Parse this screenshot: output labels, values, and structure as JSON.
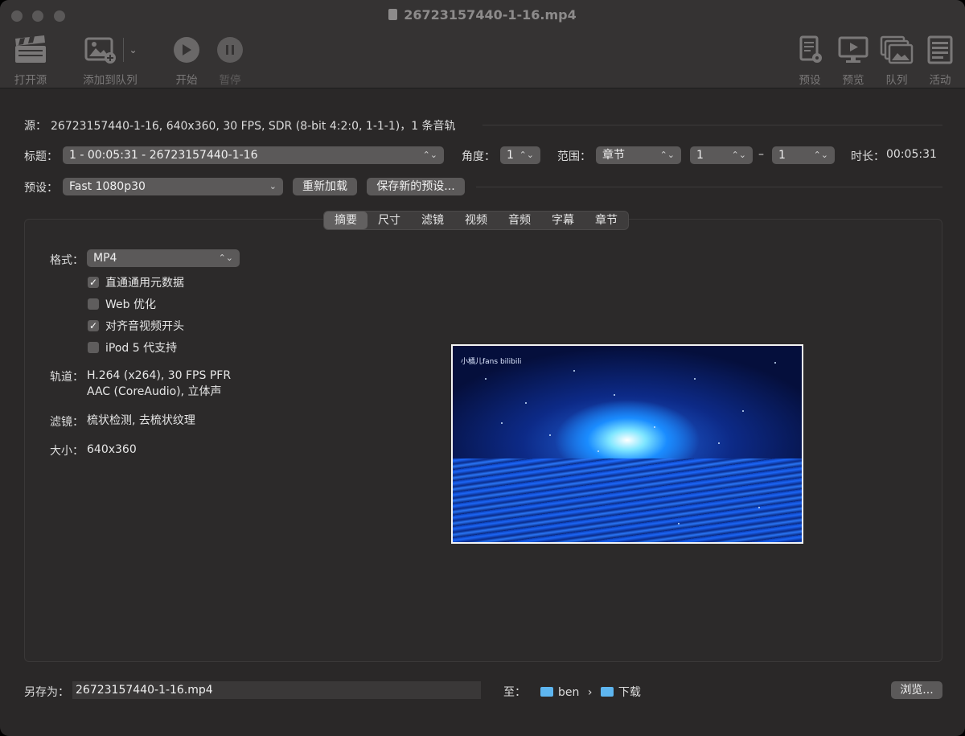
{
  "window": {
    "title": "26723157440-1-16.mp4"
  },
  "toolbar": {
    "open_source": "打开源",
    "add_to_queue": "添加到队列",
    "start": "开始",
    "pause": "暂停",
    "presets": "预设",
    "preview": "预览",
    "queue": "队列",
    "activity": "活动"
  },
  "source": {
    "label": "源：",
    "value": "26723157440-1-16, 640x360, 30 FPS, SDR (8-bit 4:2:0, 1-1-1)，1 条音轨"
  },
  "title_row": {
    "label": "标题：",
    "title_value": "1 - 00:05:31 - 26723157440-1-16",
    "angle_label": "角度：",
    "angle_value": "1",
    "range_label": "范围：",
    "range_type": "章节",
    "range_start": "1",
    "range_dash": "–",
    "range_end": "1",
    "duration_label": "时长：",
    "duration_value": "00:05:31"
  },
  "preset_row": {
    "label": "预设：",
    "value": "Fast 1080p30",
    "reload_button": "重新加载",
    "save_preset_button": "保存新的预设..."
  },
  "tabs": [
    "摘要",
    "尺寸",
    "滤镜",
    "视频",
    "音频",
    "字幕",
    "章节"
  ],
  "summary": {
    "format_label": "格式：",
    "format_value": "MP4",
    "options": [
      {
        "label": "直通通用元数据",
        "checked": true
      },
      {
        "label": "Web 优化",
        "checked": false
      },
      {
        "label": "对齐音视频开头",
        "checked": true
      },
      {
        "label": "iPod 5 代支持",
        "checked": false
      }
    ],
    "tracks_label": "轨道：",
    "tracks_line1": "H.264 (x264), 30 FPS PFR",
    "tracks_line2": "AAC (CoreAudio), 立体声",
    "filters_label": "滤镜：",
    "filters_value": "梳状检测, 去梳状纹理",
    "size_label": "大小：",
    "size_value": "640x360",
    "preview_watermark": "小橘儿fans bilibili"
  },
  "footer": {
    "save_as_label": "另存为：",
    "save_as_value": "26723157440-1-16.mp4",
    "to_label": "至：",
    "path_user": "ben",
    "path_sep": "›",
    "path_folder": "下载",
    "browse_button": "浏览..."
  }
}
